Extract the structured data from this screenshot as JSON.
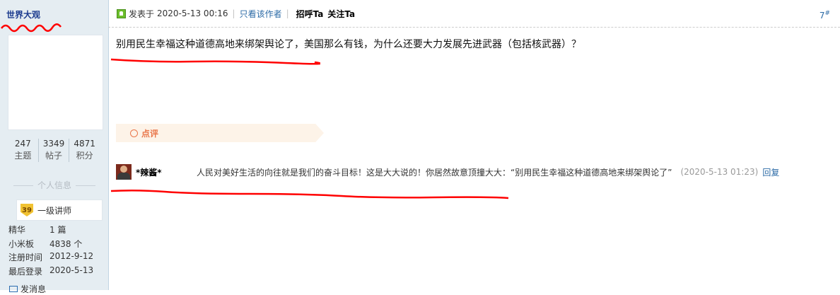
{
  "sidebar": {
    "username": "世界大观",
    "stats": [
      {
        "num": "247",
        "label": "主题"
      },
      {
        "num": "3349",
        "label": "帖子"
      },
      {
        "num": "4871",
        "label": "积分"
      }
    ],
    "section_title": "个人信息",
    "rank": {
      "level": "39",
      "title": "一级讲师"
    },
    "info": [
      {
        "key": "精华",
        "value": "1 篇"
      },
      {
        "key": "小米板",
        "value": "4838 个"
      },
      {
        "key": "注册时间",
        "value": "2012-9-12"
      },
      {
        "key": "最后登录",
        "value": "2020-5-13"
      }
    ],
    "send_message": "发消息"
  },
  "post": {
    "posted_prefix": "发表于",
    "posted_time": "2020-5-13 00:16",
    "only_author": "只看该作者",
    "greet": "招呼Ta",
    "follow": "关注Ta",
    "floor": "7",
    "floor_mark": "#",
    "content": "别用民生幸福这种道德高地来绑架舆论了，美国那么有钱，为什么还要大力发展先进武器（包括核武器）？",
    "comment_label": "点评",
    "reply": {
      "user": "*辣酱*",
      "text": "人民对美好生活的向往就是我们的奋斗目标！这是大大说的！你居然故意顶撞大大：“别用民生幸福这种道德高地来绑架舆论了”",
      "time": "(2020-5-13 01:23)",
      "action": "回复"
    }
  },
  "colors": {
    "sidebar_bg": "#e5edf2",
    "link": "#2b6aa6",
    "annotation_red": "#ff0000",
    "comment_accent": "#e9764a"
  }
}
